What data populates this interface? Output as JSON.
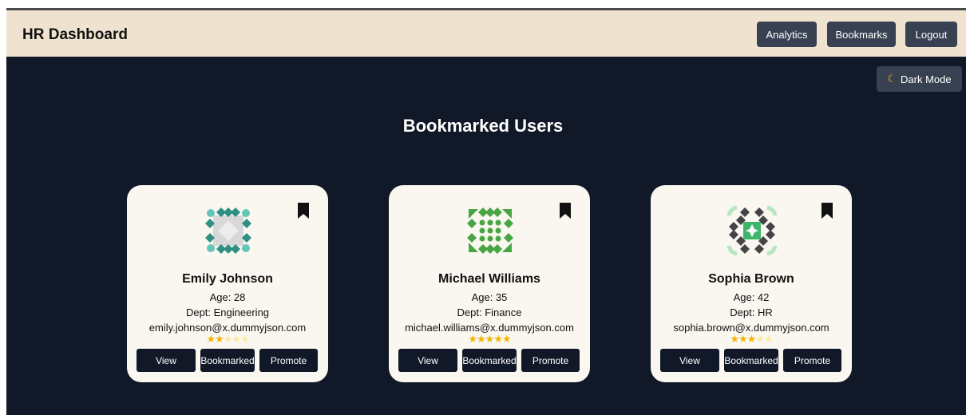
{
  "header": {
    "title": "HR Dashboard",
    "nav": {
      "analytics": "Analytics",
      "bookmarks": "Bookmarks",
      "logout": "Logout"
    }
  },
  "theme_toggle": {
    "label": "Dark Mode",
    "icon": "moon-icon"
  },
  "page_title": "Bookmarked Users",
  "colors": {
    "navbar": "#efe3cf",
    "background": "#111827",
    "card": "#faf6f0",
    "button": "#111827",
    "nav_button": "#374151",
    "star": "#f4b400"
  },
  "users": [
    {
      "name": "Emily Johnson",
      "age": "Age: 28",
      "dept": "Dept: Engineering",
      "email": "emily.johnson@x.dummyjson.com",
      "rating": 2,
      "rating_max": 5,
      "avatar_color": "#2f8f83"
    },
    {
      "name": "Michael Williams",
      "age": "Age: 35",
      "dept": "Dept: Finance",
      "email": "michael.williams@x.dummyjson.com",
      "rating": 5,
      "rating_max": 5,
      "avatar_color": "#47a643"
    },
    {
      "name": "Sophia Brown",
      "age": "Age: 42",
      "dept": "Dept: HR",
      "email": "sophia.brown@x.dummyjson.com",
      "rating": 3,
      "rating_max": 5,
      "avatar_color": "#3fb56b"
    }
  ],
  "card_buttons": {
    "view": "View",
    "bookmarked": "Bookmarked",
    "promote": "Promote"
  }
}
